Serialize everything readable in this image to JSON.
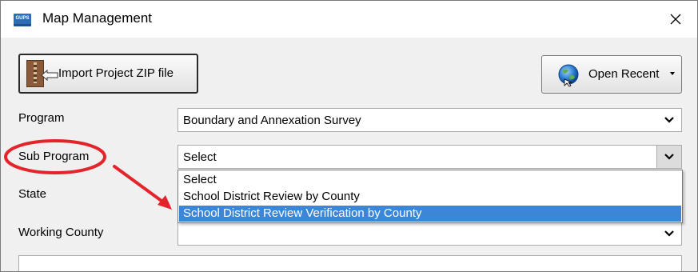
{
  "window": {
    "title": "Map Management",
    "app_icon_text": "GUPS"
  },
  "toolbar": {
    "import_label": "Import Project ZIP file",
    "open_recent_label": "Open Recent"
  },
  "form": {
    "program": {
      "label": "Program",
      "value": "Boundary and Annexation Survey"
    },
    "sub_program": {
      "label": "Sub Program",
      "value": "Select"
    },
    "state": {
      "label": "State",
      "value": ""
    },
    "working_county": {
      "label": "Working County",
      "value": ""
    }
  },
  "dropdown": {
    "options": [
      {
        "label": "Select",
        "selected": false
      },
      {
        "label": "School District Review by County",
        "selected": false
      },
      {
        "label": "School District Review Verification by County",
        "selected": true
      }
    ]
  },
  "colors": {
    "selection": "#3b86d6",
    "annotation": "#e3242b"
  }
}
